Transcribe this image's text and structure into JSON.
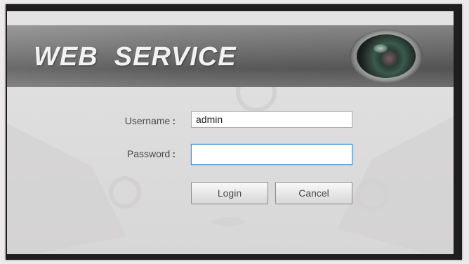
{
  "header": {
    "brand": "WEB  SERVICE"
  },
  "login": {
    "username_label": "Username",
    "password_label": "Password",
    "colon": ":",
    "username_value": "admin",
    "password_value": "",
    "login_button": "Login",
    "cancel_button": "Cancel"
  },
  "colors": {
    "header": "#6e6e6e",
    "panel": "#dedddd",
    "focus_border": "#3c8fd6"
  },
  "icons": {
    "background": "security-camera-illustration",
    "header": "camera-lens-icon"
  }
}
